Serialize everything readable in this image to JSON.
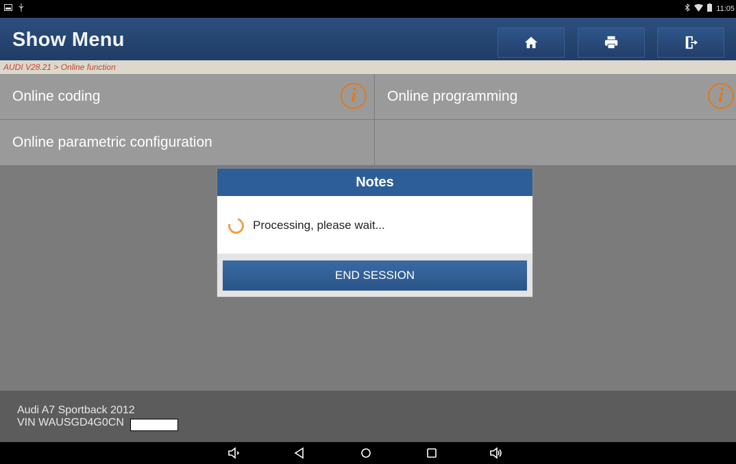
{
  "status_bar": {
    "time": "11:05"
  },
  "header": {
    "title": "Show Menu"
  },
  "breadcrumb": "AUDI V28.21 > Online function",
  "menu": {
    "items": [
      {
        "label": "Online coding",
        "info_glyph": "i"
      },
      {
        "label": "Online programming",
        "info_glyph": "i"
      },
      {
        "label": "Online parametric configuration"
      }
    ]
  },
  "dialog": {
    "title": "Notes",
    "message": "Processing, please wait...",
    "button_label": "END SESSION"
  },
  "vehicle": {
    "model": "Audi A7 Sportback 2012",
    "vin": "VIN WAUSGD4G0CN"
  },
  "colors": {
    "header_bg": "#1f3d66",
    "breadcrumb_text": "#c4442e",
    "info_icon": "#e07a1c",
    "dialog_title_bg": "#2e5e97",
    "button_bg": "#2a5589",
    "spinner": "#f1a041"
  },
  "icons": [
    "home-icon",
    "print-icon",
    "exit-icon",
    "info-icon",
    "spinner-icon",
    "volume-down-icon",
    "back-icon",
    "home-circle-icon",
    "recents-icon",
    "volume-up-icon"
  ]
}
